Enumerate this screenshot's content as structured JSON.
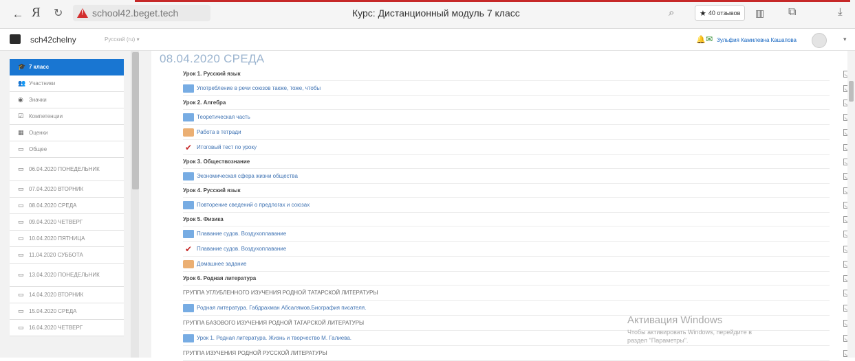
{
  "browser": {
    "url": "school42.beget.tech",
    "title": "Курс: Дистанционный модуль 7 класс",
    "reviews_label": "40 отзывов"
  },
  "navbar": {
    "site_name": "sch42chelny",
    "language": "Русский (ru) ▾",
    "user_name": "Зульфия Камилевна Кашапова",
    "user_caret": "▾"
  },
  "drawer": {
    "items": [
      {
        "label": "7 класс",
        "icon": "graduation-cap-icon",
        "active": true
      },
      {
        "label": "Участники",
        "icon": "users-icon"
      },
      {
        "label": "Значки",
        "icon": "badge-icon"
      },
      {
        "label": "Компетенции",
        "icon": "competencies-icon"
      },
      {
        "label": "Оценки",
        "icon": "grades-icon"
      },
      {
        "label": "Общее",
        "icon": "folder-icon"
      },
      {
        "label": "06.04.2020 ПОНЕДЕЛЬНИК",
        "icon": "folder-icon",
        "tall": true
      },
      {
        "label": "07.04.2020 ВТОРНИК",
        "icon": "folder-icon"
      },
      {
        "label": "08.04.2020 СРЕДА",
        "icon": "folder-icon"
      },
      {
        "label": "09.04.2020 ЧЕТВЕРГ",
        "icon": "folder-icon"
      },
      {
        "label": "10.04.2020 ПЯТНИЦА",
        "icon": "folder-icon"
      },
      {
        "label": "11.04.2020 СУББОТА",
        "icon": "folder-icon"
      },
      {
        "label": "13.04.2020 ПОНЕДЕЛЬНИК",
        "icon": "folder-icon",
        "tall": true
      },
      {
        "label": "14.04.2020 ВТОРНИК",
        "icon": "folder-icon"
      },
      {
        "label": "15.04.2020 СРЕДА",
        "icon": "folder-icon"
      },
      {
        "label": "16.04.2020 ЧЕТВЕРГ",
        "icon": "folder-icon"
      }
    ]
  },
  "section": {
    "title": "08.04.2020 СРЕДА",
    "rows": [
      {
        "kind": "label",
        "text": "Урок 1. Русский язык"
      },
      {
        "kind": "link",
        "icon": "page",
        "text": "Употребление в речи союзов также, тоже, чтобы"
      },
      {
        "kind": "label",
        "text": "Урок 2. Алгебра"
      },
      {
        "kind": "link",
        "icon": "page",
        "text": "Теоретическая часть"
      },
      {
        "kind": "link",
        "icon": "assign",
        "text": "Работа в тетради"
      },
      {
        "kind": "link",
        "icon": "quiz",
        "text": "Итоговый тест по уроку"
      },
      {
        "kind": "label",
        "text": "Урок 3. Обществознание"
      },
      {
        "kind": "link",
        "icon": "page",
        "text": "Экономическая сфера жизни общества"
      },
      {
        "kind": "label",
        "text": "Урок 4. Русский язык"
      },
      {
        "kind": "link",
        "icon": "page",
        "text": "Повторение сведений о предлогах и союзах"
      },
      {
        "kind": "label",
        "text": "Урок 5. Физика"
      },
      {
        "kind": "link",
        "icon": "page",
        "text": "Плавание судов. Воздухоплавание"
      },
      {
        "kind": "link",
        "icon": "quiz",
        "text": "Плавание судов. Воздухоплавание"
      },
      {
        "kind": "link",
        "icon": "assign",
        "text": "Домашнее задание"
      },
      {
        "kind": "label",
        "text": "Урок 6. Родная литература"
      },
      {
        "kind": "group",
        "text": "ГРУППА УГЛУБЛЕННОГО ИЗУЧЕНИЯ РОДНОЙ ТАТАРСКОЙ ЛИТЕРАТУРЫ"
      },
      {
        "kind": "link",
        "icon": "page",
        "text": "Родная литература. Габдрахман Абсалямов.Биография писателя."
      },
      {
        "kind": "group",
        "text": "ГРУППА БАЗОВОГО ИЗУЧЕНИЯ РОДНОЙ ТАТАРСКОЙ ЛИТЕРАТУРЫ"
      },
      {
        "kind": "link",
        "icon": "page",
        "text": "Урок 1. Родная литература. Жизнь и творчество М. Галиева."
      },
      {
        "kind": "group",
        "text": "ГРУППА ИЗУЧЕНИЯ РОДНОЙ РУССКОЙ ЛИТЕРАТУРЫ"
      }
    ]
  },
  "watermark": {
    "title": "Активация Windows",
    "line1": "Чтобы активировать Windows, перейдите в",
    "line2": "раздел \"Параметры\"."
  },
  "colors": {
    "accent": "#1976d2",
    "link": "#3f73b3",
    "section_title": "#9bb4cf",
    "warning": "#d32f2f"
  }
}
